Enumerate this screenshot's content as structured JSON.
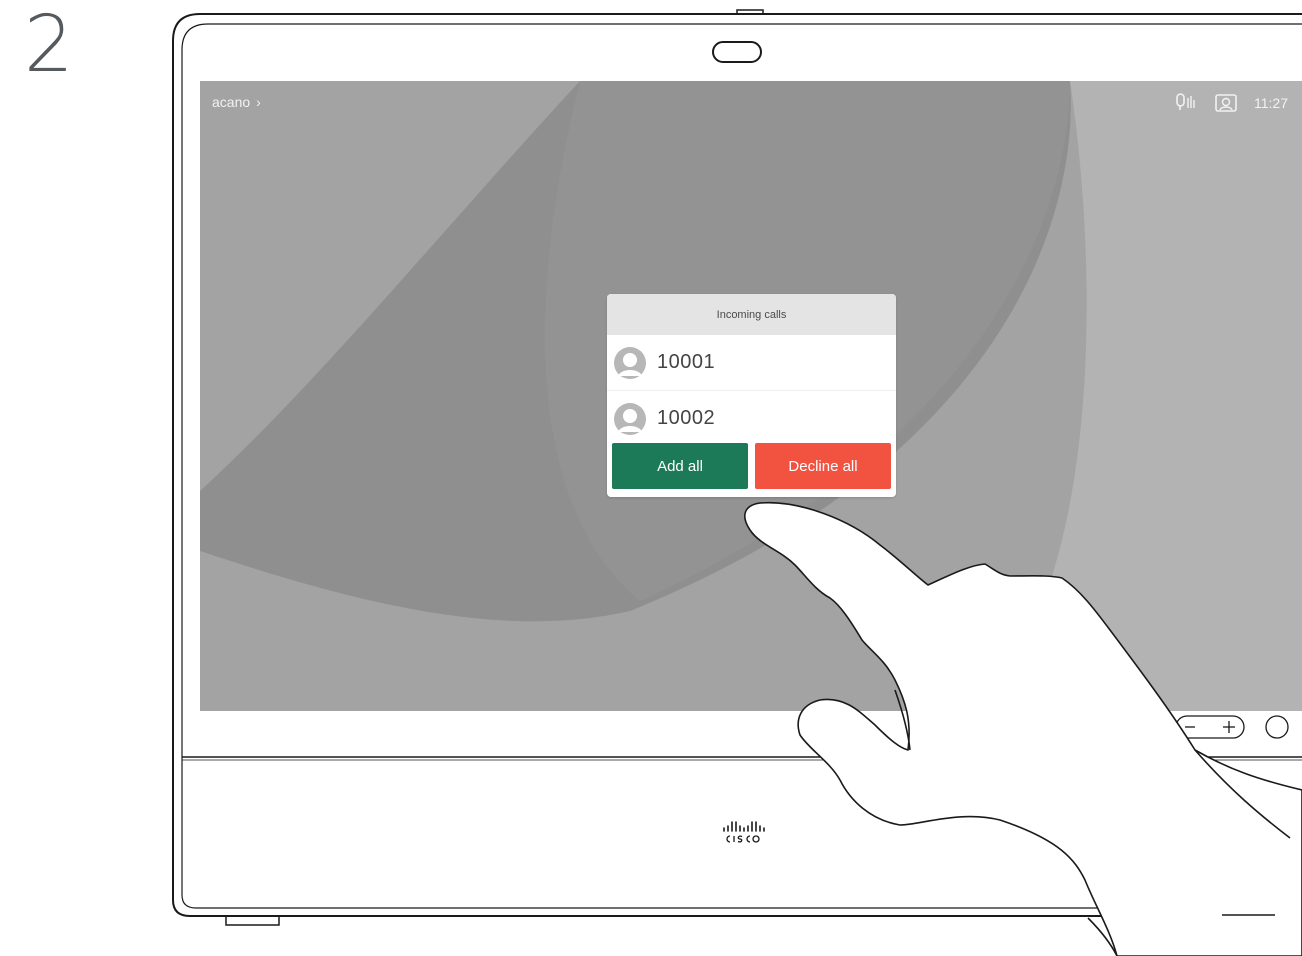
{
  "step": {
    "number": "2"
  },
  "screen": {
    "topbar": {
      "left_label": "acano",
      "chevron_icon": "chevron-right-icon",
      "icons": [
        "microphone-mute-icon",
        "self-view-icon"
      ],
      "time": "11:27"
    }
  },
  "dialog": {
    "title": "Incoming calls",
    "callers": [
      {
        "name": "10001",
        "icon": "avatar-icon"
      },
      {
        "name": "10002",
        "icon": "avatar-icon"
      }
    ],
    "buttons": {
      "add_all": "Add all",
      "decline_all": "Decline all"
    }
  },
  "device": {
    "controls": [
      "volume-control",
      "round-button"
    ],
    "brand_logo": "cisco-logo"
  },
  "colors": {
    "add_button": "#1d7a58",
    "decline_button": "#f25240",
    "dialog_header": "#e4e4e4",
    "screen_background": "#a2a2a2"
  }
}
